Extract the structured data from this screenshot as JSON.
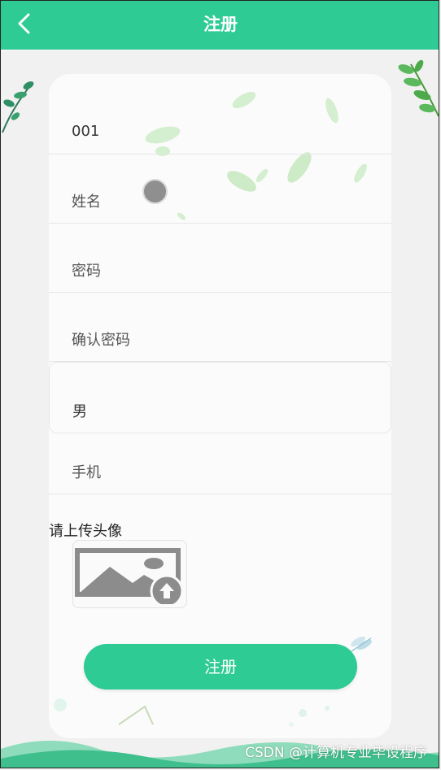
{
  "header": {
    "title": "注册",
    "back_icon": "chevron-left-icon"
  },
  "form": {
    "account_value": "001",
    "name_placeholder": "姓名",
    "password_placeholder": "密码",
    "confirm_password_placeholder": "确认密码",
    "gender_selected": "男",
    "phone_placeholder": "手机",
    "upload_label": "请上传头像",
    "upload_icon": "image-upload-icon",
    "submit_label": "注册"
  },
  "watermark": "CSDN @计算机专业毕设程序",
  "colors": {
    "accent": "#2ecb95",
    "background": "#f1f1f1",
    "card": "#fbfbfb",
    "leaf_green": "#c8ecc6",
    "branch_green": "#3a9a5a"
  }
}
